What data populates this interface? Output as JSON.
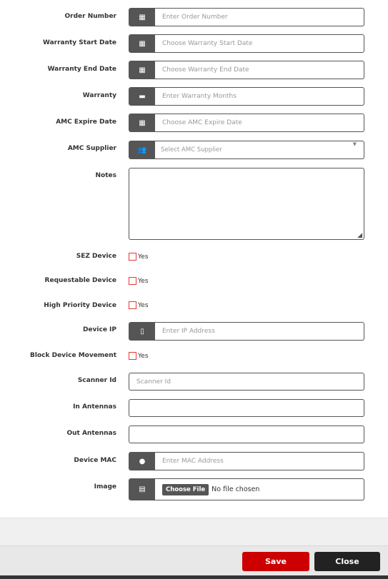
{
  "fields": {
    "order_number": {
      "label": "Order Number",
      "placeholder": "Enter Order Number",
      "icon": "calendar-icon"
    },
    "warranty_start": {
      "label": "Warranty Start Date",
      "placeholder": "Choose Warranty Start Date",
      "icon": "calendar-icon"
    },
    "warranty_end": {
      "label": "Warranty End Date",
      "placeholder": "Choose Warranty End Date",
      "icon": "calendar-icon"
    },
    "warranty": {
      "label": "Warranty",
      "placeholder": "Enter Warranty Months",
      "icon": "briefcase-icon"
    },
    "amc_expire": {
      "label": "AMC Expire Date",
      "placeholder": "Choose AMC Expire Date",
      "icon": "calendar-icon"
    },
    "amc_supplier": {
      "label": "AMC Supplier",
      "placeholder": "Select AMC Supplier",
      "icon": "users-icon"
    },
    "notes": {
      "label": "Notes"
    },
    "sez": {
      "label": "SEZ Device",
      "option": "Yes"
    },
    "requestable": {
      "label": "Requestable Device",
      "option": "Yes"
    },
    "high_priority": {
      "label": "High Priority Device",
      "option": "Yes"
    },
    "device_ip": {
      "label": "Device IP",
      "placeholder": "Enter IP Address",
      "icon": "tablet-icon"
    },
    "block_movement": {
      "label": "Block Device Movement",
      "option": "Yes"
    },
    "scanner_id": {
      "label": "Scanner Id",
      "placeholder": "Scanner Id"
    },
    "in_antennas": {
      "label": "In Antennas"
    },
    "out_antennas": {
      "label": "Out Antennas"
    },
    "device_mac": {
      "label": "Device MAC",
      "placeholder": "Enter MAC Address",
      "icon": "apple-icon"
    },
    "image": {
      "label": "Image",
      "button": "Choose File",
      "status": "No file chosen",
      "icon": "file-icon"
    }
  },
  "footer": {
    "save": "Save",
    "close": "Close"
  },
  "colors": {
    "save": "#cc0000",
    "close": "#222222",
    "icon_bg": "#555555",
    "checkbox": "#e53935"
  }
}
